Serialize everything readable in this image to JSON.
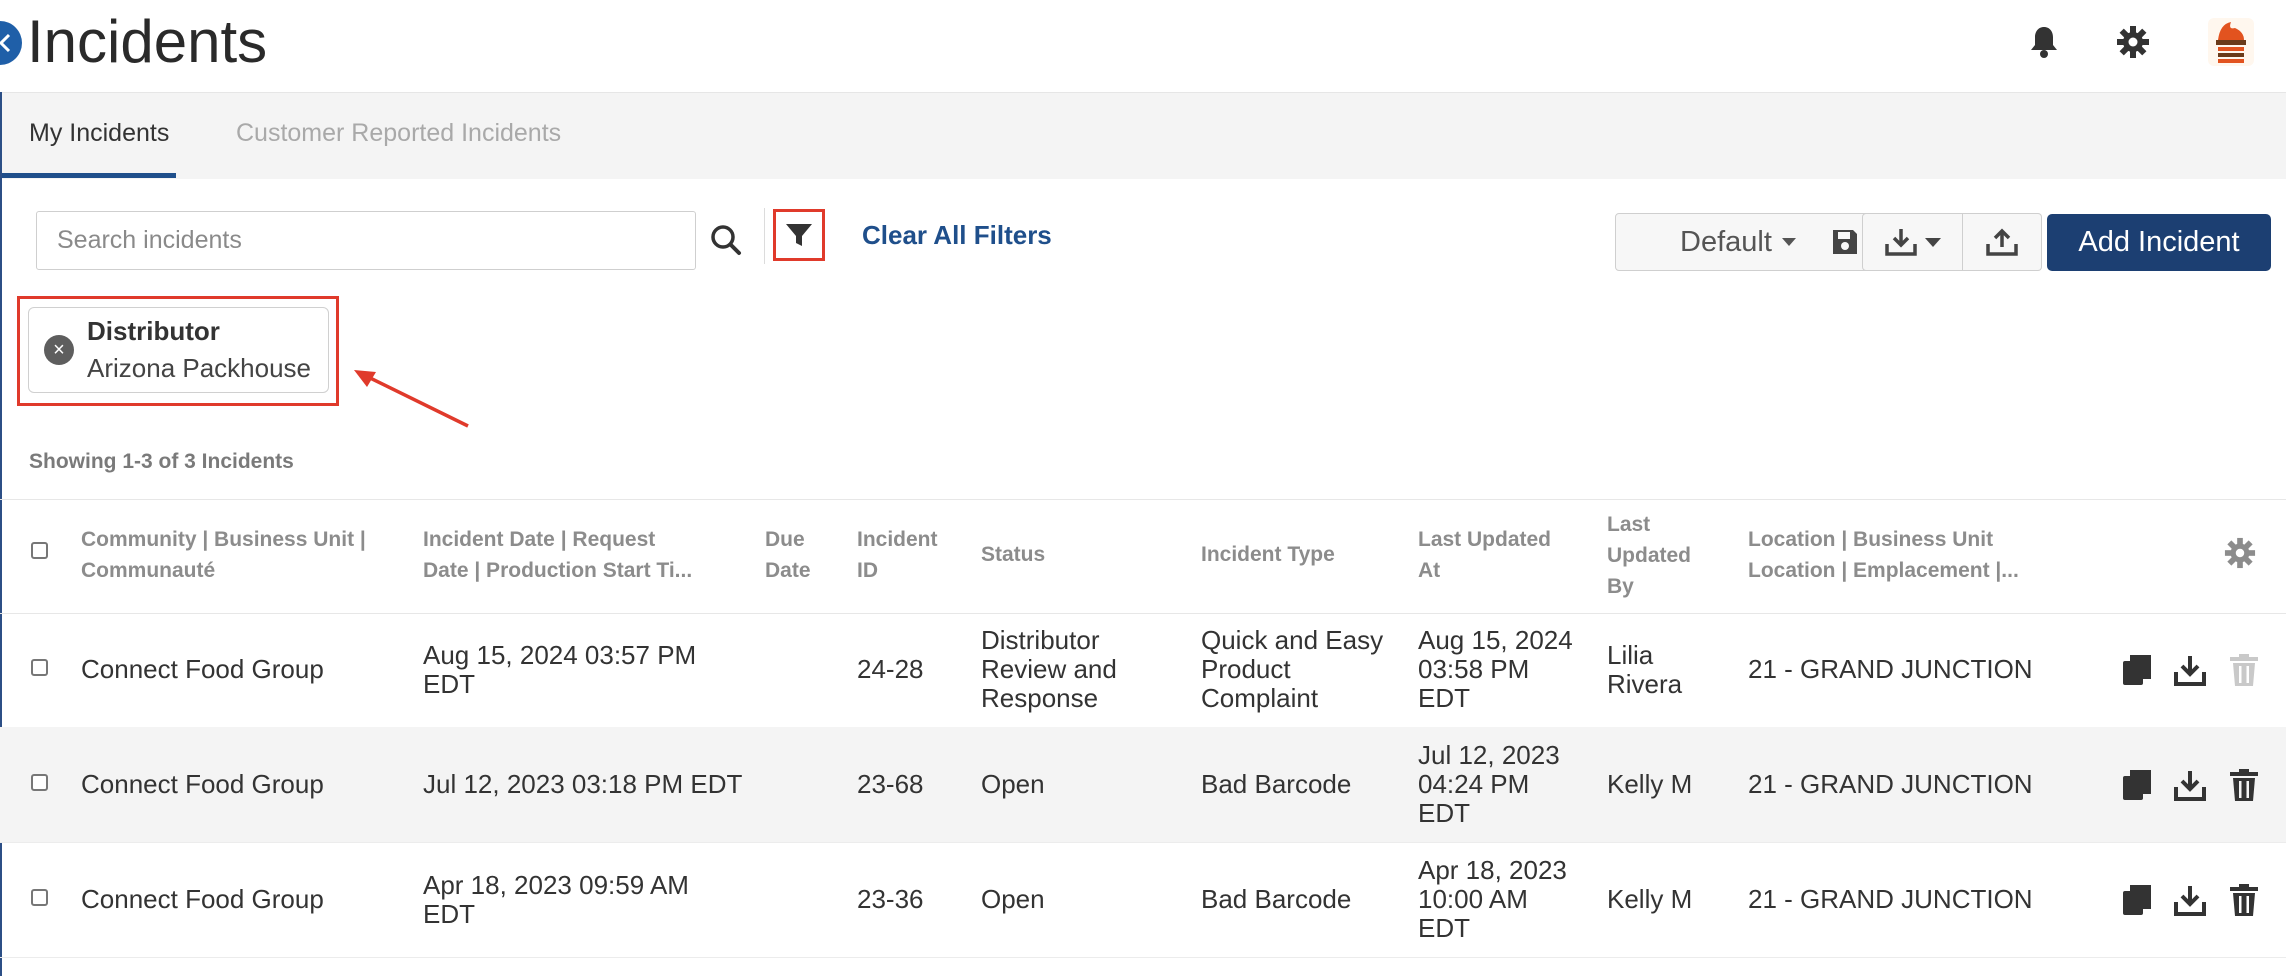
{
  "header": {
    "title": "Incidents",
    "icons": [
      "back-icon",
      "bell-icon",
      "gear-icon",
      "avatar-logo"
    ]
  },
  "tabs": [
    {
      "label": "My Incidents",
      "active": true
    },
    {
      "label": "Customer Reported Incidents",
      "active": false
    }
  ],
  "toolbar": {
    "search_placeholder": "Search incidents",
    "clear_filters": "Clear All Filters",
    "view_selected": "Default",
    "add_label": "Add Incident"
  },
  "filter_chip": {
    "label": "Distributor",
    "value": "Arizona Packhouse"
  },
  "showing_text": "Showing 1-3 of 3 Incidents",
  "table": {
    "headers": {
      "community_l1": "Community | Business Unit |",
      "community_l2": "Communauté",
      "date_l1": "Incident Date | Request",
      "date_l2": "Date | Production Start Ti...",
      "due_l1": "Due",
      "due_l2": "Date",
      "id_l1": "Incident",
      "id_l2": "ID",
      "status": "Status",
      "type": "Incident Type",
      "updated_at_l1": "Last Updated",
      "updated_at_l2": "At",
      "updated_by_l1": "Last",
      "updated_by_l2": "Updated",
      "updated_by_l3": "By",
      "location_l1": "Location | Business Unit",
      "location_l2": "Location | Emplacement |..."
    },
    "rows": [
      {
        "community": "Connect Food Group",
        "date_l1": "Aug 15, 2024 03:57 PM",
        "date_l2": "EDT",
        "due": "",
        "id": "24-28",
        "status_l1": "Distributor",
        "status_l2": "Review and",
        "status_l3": "Response",
        "type_l1": "Quick and Easy",
        "type_l2": "Product",
        "type_l3": "Complaint",
        "upd_l1": "Aug 15, 2024",
        "upd_l2": "03:58 PM",
        "upd_l3": "EDT",
        "by_l1": "Lilia",
        "by_l2": "Rivera",
        "location": "21 - GRAND JUNCTION",
        "delete_disabled": true
      },
      {
        "community": "Connect Food Group",
        "date_l1": "Jul 12, 2023 03:18 PM EDT",
        "date_l2": "",
        "due": "",
        "id": "23-68",
        "status_l1": "Open",
        "status_l2": "",
        "status_l3": "",
        "type_l1": "Bad Barcode",
        "type_l2": "",
        "type_l3": "",
        "upd_l1": "Jul 12, 2023",
        "upd_l2": "04:24 PM",
        "upd_l3": "EDT",
        "by_l1": "Kelly M",
        "by_l2": "",
        "location": "21 - GRAND JUNCTION",
        "delete_disabled": false
      },
      {
        "community": "Connect Food Group",
        "date_l1": "Apr 18, 2023 09:59 AM",
        "date_l2": "EDT",
        "due": "",
        "id": "23-36",
        "status_l1": "Open",
        "status_l2": "",
        "status_l3": "",
        "type_l1": "Bad Barcode",
        "type_l2": "",
        "type_l3": "",
        "upd_l1": "Apr 18, 2023",
        "upd_l2": "10:00 AM",
        "upd_l3": "EDT",
        "by_l1": "Kelly M",
        "by_l2": "",
        "location": "21 - GRAND JUNCTION",
        "delete_disabled": false
      }
    ]
  },
  "colors": {
    "primary": "#1c3f72",
    "link": "#1f4f8b",
    "highlight": "#e03a2b"
  }
}
